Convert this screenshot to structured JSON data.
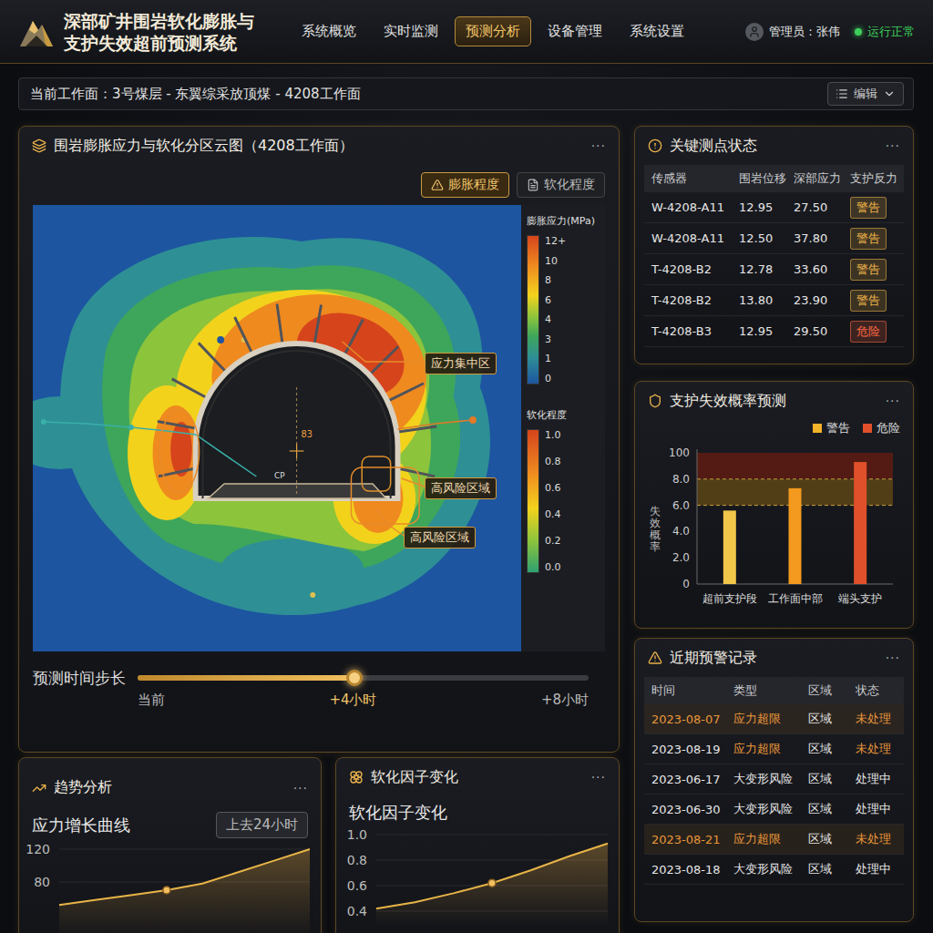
{
  "header": {
    "title_lines": [
      "深部矿井围岩软化膨胀与",
      "支护失效超前预测系统"
    ],
    "nav": [
      {
        "label": "系统概览",
        "selected": false
      },
      {
        "label": "实时监测",
        "selected": false
      },
      {
        "label": "预测分析",
        "selected": true
      },
      {
        "label": "设备管理",
        "selected": false
      },
      {
        "label": "系统设置",
        "selected": false
      }
    ],
    "user": "管理员：张伟",
    "status": {
      "label": "运行正常",
      "color": "#3ecf5a"
    }
  },
  "breadcrumb": {
    "text": "当前工作面：3号煤层 - 东翼综采放顶煤 - 4208工作面",
    "edit": "编辑"
  },
  "map_panel": {
    "title": "围岩膨胀应力与软化分区云图（4208工作面）",
    "menu": "···",
    "modes": [
      {
        "label": "膨胀程度",
        "selected": true
      },
      {
        "label": "软化程度",
        "selected": false
      }
    ],
    "stress_legend": {
      "title": "膨胀应力(MPa)",
      "ticks": [
        "12+",
        "10",
        "8",
        "6",
        "4",
        "3",
        "1",
        "0"
      ]
    },
    "soft_legend": {
      "title": "软化程度",
      "ticks": [
        "1.0",
        "0.8",
        "0.6",
        "0.4",
        "0.2",
        "0.0"
      ]
    },
    "zones": [
      {
        "label": "应力集中区"
      },
      {
        "label": "高风险区域"
      },
      {
        "label": "高风险区域"
      }
    ],
    "marks": [
      "83",
      "CP"
    ],
    "slider": {
      "label": "预测时间步长",
      "level": 0.48,
      "ticks": [
        {
          "label": "当前",
          "selected": false
        },
        {
          "label": "+4小时",
          "selected": true
        },
        {
          "label": "+8小时",
          "selected": false
        }
      ]
    }
  },
  "sensor_panel": {
    "title": "关键测点状态",
    "menu": "···",
    "columns": [
      "传感器",
      "围岩位移",
      "深部应力",
      "支护反力"
    ],
    "rows": [
      {
        "sensor": "W-4208-A11",
        "displacement": "12.95",
        "stress": "27.50",
        "status": "警告",
        "color": "#f0b54a"
      },
      {
        "sensor": "W-4208-A11",
        "displacement": "12.50",
        "stress": "37.80",
        "status": "警告",
        "color": "#f0b54a"
      },
      {
        "sensor": "T-4208-B2",
        "displacement": "12.78",
        "stress": "33.60",
        "status": "警告",
        "color": "#f0b54a"
      },
      {
        "sensor": "T-4208-B2",
        "displacement": "13.80",
        "stress": "23.90",
        "status": "警告",
        "color": "#f0b54a"
      },
      {
        "sensor": "T-4208-B3",
        "displacement": "12.95",
        "stress": "29.50",
        "status": "危险",
        "color": "#ff6a45"
      }
    ]
  },
  "probability_panel": {
    "title": "支护失效概率预测",
    "menu": "···",
    "legend": [
      {
        "label": "警告",
        "color": "#f2b22a"
      },
      {
        "label": "危险",
        "color": "#e0502a"
      }
    ],
    "y_label": "失效概率",
    "y_ticks": [
      "100",
      "8.0",
      "6.0",
      "4.0",
      "2.0",
      "0"
    ],
    "y_max": 10,
    "bands": [
      {
        "from": 6,
        "to": 8,
        "color": "#5c4516"
      },
      {
        "from": 8,
        "to": 10,
        "color": "#5e1c12"
      }
    ],
    "bars": [
      {
        "label": "超前支护段",
        "value": 5.6,
        "color": "#f2c64a"
      },
      {
        "label": "工作面中部",
        "value": 7.3,
        "color": "#f39a1e"
      },
      {
        "label": "端头支护",
        "value": 9.3,
        "color": "#e0502a"
      }
    ]
  },
  "alerts_panel": {
    "title": "近期预警记录",
    "menu": "···",
    "columns": [
      "时间",
      "类型",
      "区域",
      "状态"
    ],
    "rows": [
      {
        "time": "2023-08-07",
        "highlighted": true,
        "type": "应力超限",
        "type_color": "#e8963a",
        "area": "区域",
        "state": "未处理",
        "state_color": "#e8963a"
      },
      {
        "time": "2023-08-19",
        "highlighted": false,
        "type": "应力超限",
        "type_color": "#e8963a",
        "area": "区域",
        "state": "未处理",
        "state_color": "#e8963a"
      },
      {
        "time": "2023-06-17",
        "highlighted": false,
        "type": "大变形风险",
        "type_color": "#e6e6e6",
        "area": "区域",
        "state": "处理中",
        "state_color": "#e6e6e6"
      },
      {
        "time": "2023-06-30",
        "highlighted": false,
        "type": "大变形风险",
        "type_color": "#e6e6e6",
        "area": "区域",
        "state": "处理中",
        "state_color": "#e6e6e6"
      },
      {
        "time": "2023-08-21",
        "highlighted": true,
        "type": "应力超限",
        "type_color": "#e8963a",
        "area": "区域",
        "state": "未处理",
        "state_color": "#e8963a"
      },
      {
        "time": "2023-08-18",
        "highlighted": false,
        "type": "大变形风险",
        "type_color": "#e6e6e6",
        "area": "区域",
        "state": "处理中",
        "state_color": "#e6e6e6"
      }
    ]
  },
  "trend_panel": {
    "title": "趋势分析",
    "menu": "···",
    "subtitle": "应力增长曲线",
    "range_button": "上去24小时",
    "y_ticks": [
      "120",
      "80"
    ],
    "series": [
      52,
      58,
      64,
      70,
      78,
      92,
      106,
      120
    ],
    "highlight_index": 3
  },
  "soft_panel": {
    "title": "软化因子变化",
    "menu": "···",
    "subtitle": "软化因子变化",
    "y_ticks": [
      "1.0",
      "0.8",
      "0.6",
      "0.4"
    ],
    "series": [
      0.42,
      0.47,
      0.54,
      0.62,
      0.72,
      0.83,
      0.93
    ],
    "highlight_index": 3
  }
}
